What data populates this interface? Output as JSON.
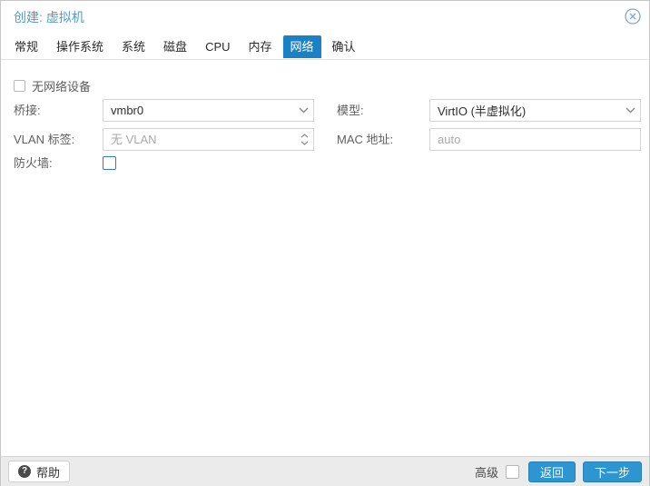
{
  "dialog": {
    "title": "创建: 虚拟机"
  },
  "icons": {
    "close": "circle-x-icon",
    "help": "question-circle-icon",
    "combo_trigger": "chevron-down-icon",
    "spinner": "chevron-up-down-icon"
  },
  "tabs": [
    {
      "label": "常规",
      "active": false
    },
    {
      "label": "操作系统",
      "active": false
    },
    {
      "label": "系统",
      "active": false
    },
    {
      "label": "磁盘",
      "active": false
    },
    {
      "label": "CPU",
      "active": false
    },
    {
      "label": "内存",
      "active": false
    },
    {
      "label": "网络",
      "active": true
    },
    {
      "label": "确认",
      "active": false
    }
  ],
  "form": {
    "no_network_device": {
      "label": "无网络设备",
      "checked": false
    },
    "bridge": {
      "label": "桥接:",
      "value": "vmbr0",
      "type": "combo"
    },
    "model": {
      "label": "模型:",
      "value": "VirtIO (半虚拟化)",
      "type": "combo"
    },
    "vlan": {
      "label": "VLAN 标签:",
      "value": "",
      "placeholder": "无 VLAN",
      "type": "number-spinner"
    },
    "mac": {
      "label": "MAC 地址:",
      "value": "",
      "placeholder": "auto",
      "type": "text"
    },
    "firewall": {
      "label": "防火墙:",
      "checked": false
    }
  },
  "footer": {
    "help_label": "帮助",
    "advanced_label": "高级",
    "advanced_checked": false,
    "back_label": "返回",
    "next_label": "下一步"
  },
  "colors": {
    "accent_tab_blue": "#1a82c4",
    "button_blue": "#2e95d3",
    "title_blue": "#4f9cce",
    "footer_gray": "#ebebeb"
  }
}
